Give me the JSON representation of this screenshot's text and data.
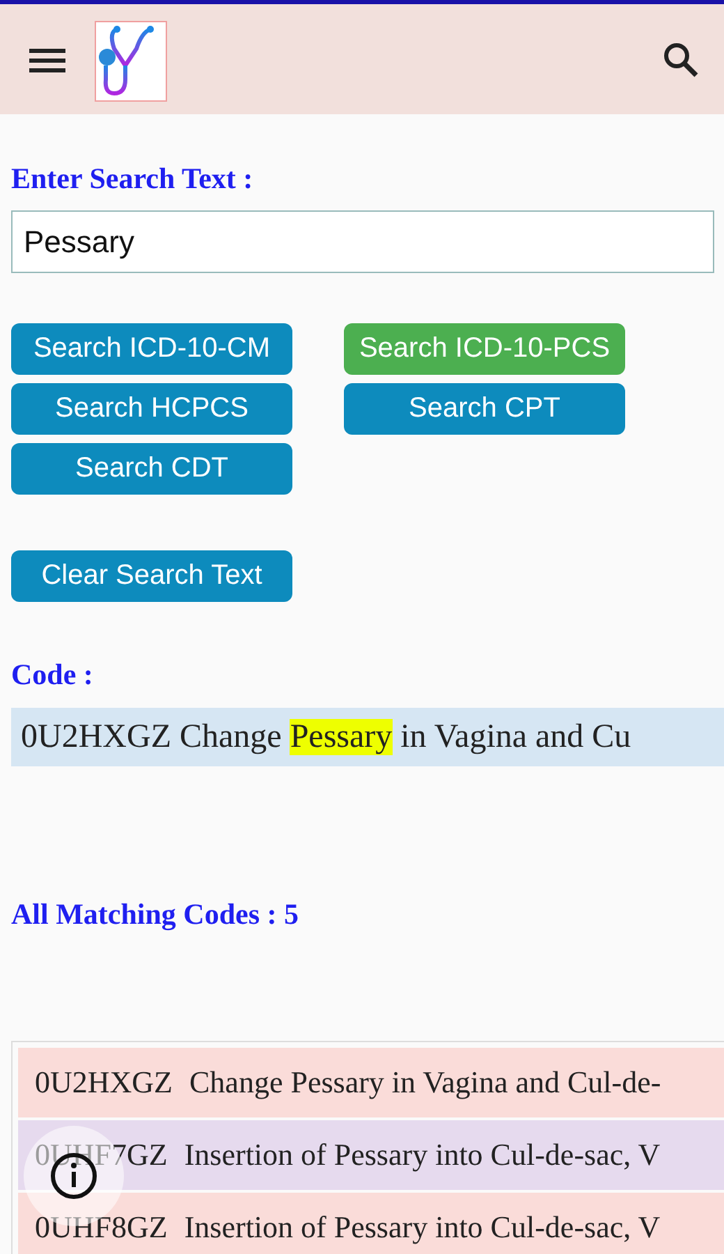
{
  "search": {
    "label": "Enter Search Text :",
    "value": "Pessary"
  },
  "buttons": [
    {
      "label": "Search ICD-10-CM",
      "selected": false
    },
    {
      "label": "Search ICD-10-PCS",
      "selected": true
    },
    {
      "label": "Search HCPCS",
      "selected": false
    },
    {
      "label": "Search CPT",
      "selected": false
    },
    {
      "label": "Search CDT",
      "selected": false
    }
  ],
  "clear_button": "Clear Search Text",
  "code": {
    "label": "Code :",
    "before": "0U2HXGZ Change ",
    "highlight": "Pessary",
    "after": " in Vagina and Cu"
  },
  "matches_label": "All Matching Codes : 5",
  "rows": [
    {
      "code": "0U2HXGZ",
      "description": "Change Pessary in Vagina and Cul-de-",
      "color": "#fadcd9"
    },
    {
      "code": "0UHF7GZ",
      "description": "Insertion of Pessary into Cul-de-sac, V",
      "color": "#e6daee"
    },
    {
      "code": "0UHF8GZ",
      "description": "Insertion of Pessary into Cul-de-sac, V",
      "color": "#fadcd9"
    }
  ]
}
